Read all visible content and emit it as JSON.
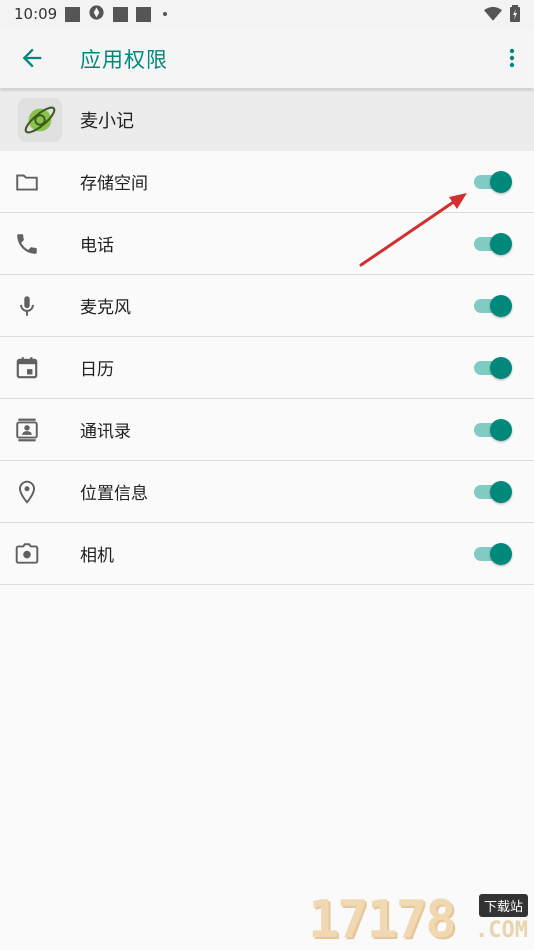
{
  "status_bar": {
    "time": "10:09"
  },
  "toolbar": {
    "title": "应用权限"
  },
  "app": {
    "name": "麦小记"
  },
  "permissions": [
    {
      "label": "存储空间",
      "icon": "folder-icon",
      "enabled": true
    },
    {
      "label": "电话",
      "icon": "phone-icon",
      "enabled": true
    },
    {
      "label": "麦克风",
      "icon": "microphone-icon",
      "enabled": true
    },
    {
      "label": "日历",
      "icon": "calendar-icon",
      "enabled": true
    },
    {
      "label": "通讯录",
      "icon": "contacts-icon",
      "enabled": true
    },
    {
      "label": "位置信息",
      "icon": "location-icon",
      "enabled": true
    },
    {
      "label": "相机",
      "icon": "camera-icon",
      "enabled": true
    }
  ],
  "watermark": {
    "digits": "17178",
    "badge": "下载站",
    "suffix": ".COM"
  },
  "colors": {
    "accent": "#00897b",
    "track": "#80cbc4",
    "annotation": "#e02020"
  }
}
